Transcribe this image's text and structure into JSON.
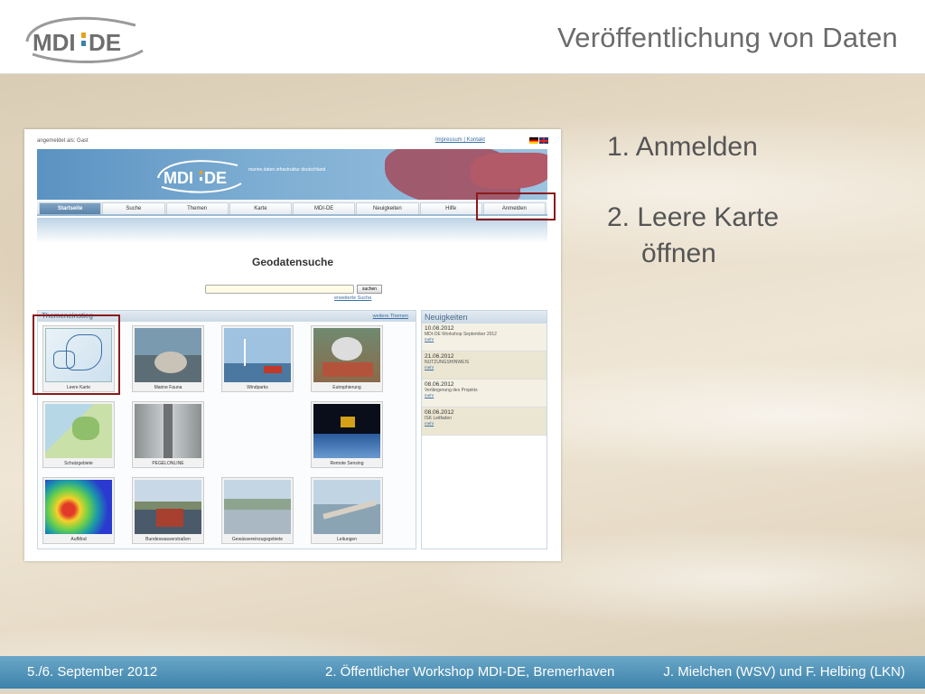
{
  "header": {
    "title": "Veröffentlichung von Daten",
    "logo_text": "MDI-DE"
  },
  "portal": {
    "login_info": "angemeldet als: Gast",
    "top_links": "Impressum | Kontakt",
    "banner_tagline": "marine.daten.infrastruktur deutschland",
    "nav": [
      "Startseite",
      "Suche",
      "Themen",
      "Karte",
      "MDI-DE",
      "Neuigkeiten",
      "Hilfe",
      "Anmelden"
    ],
    "search_title": "Geodatensuche",
    "search_button": "suchen",
    "advanced_search": "erweiterte Suche",
    "themes_title": "Themeneinstieg",
    "more_themes": "weitere Themen",
    "tiles": [
      "Leere Karte",
      "Marine Fauna",
      "Windparks",
      "Eutrophierung",
      "Schutzgebiete",
      "PEGELONLINE",
      "Remote Sensing",
      "AufMod",
      "Bundeswasserstraßen",
      "Gewässereinzugsgebiete",
      "Leitungen"
    ],
    "news_title": "Neuigkeiten",
    "news": [
      {
        "date": "10.08.2012",
        "text": "MDI-DE Workshop September 2012",
        "more": "mehr"
      },
      {
        "date": "21.06.2012",
        "text": "NUTZUNGSHINWEIS",
        "more": "mehr"
      },
      {
        "date": "08.06.2012",
        "text": "Verlängerung des Projekts",
        "more": "mehr"
      },
      {
        "date": "08.06.2012",
        "text": "ISK Leitfaden",
        "more": "mehr"
      }
    ]
  },
  "steps": {
    "step1": "1. Anmelden",
    "step2_line1": "2. Leere Karte",
    "step2_line2": "öffnen"
  },
  "footer": {
    "left": "5./6. September 2012",
    "center": "2. Öffentlicher Workshop MDI-DE, Bremerhaven",
    "right": "J. Mielchen (WSV) und F. Helbing (LKN)"
  },
  "colors": {
    "footer": "#4a8fb6",
    "highlight": "#8a1a1a",
    "title": "#6b6b6b"
  }
}
